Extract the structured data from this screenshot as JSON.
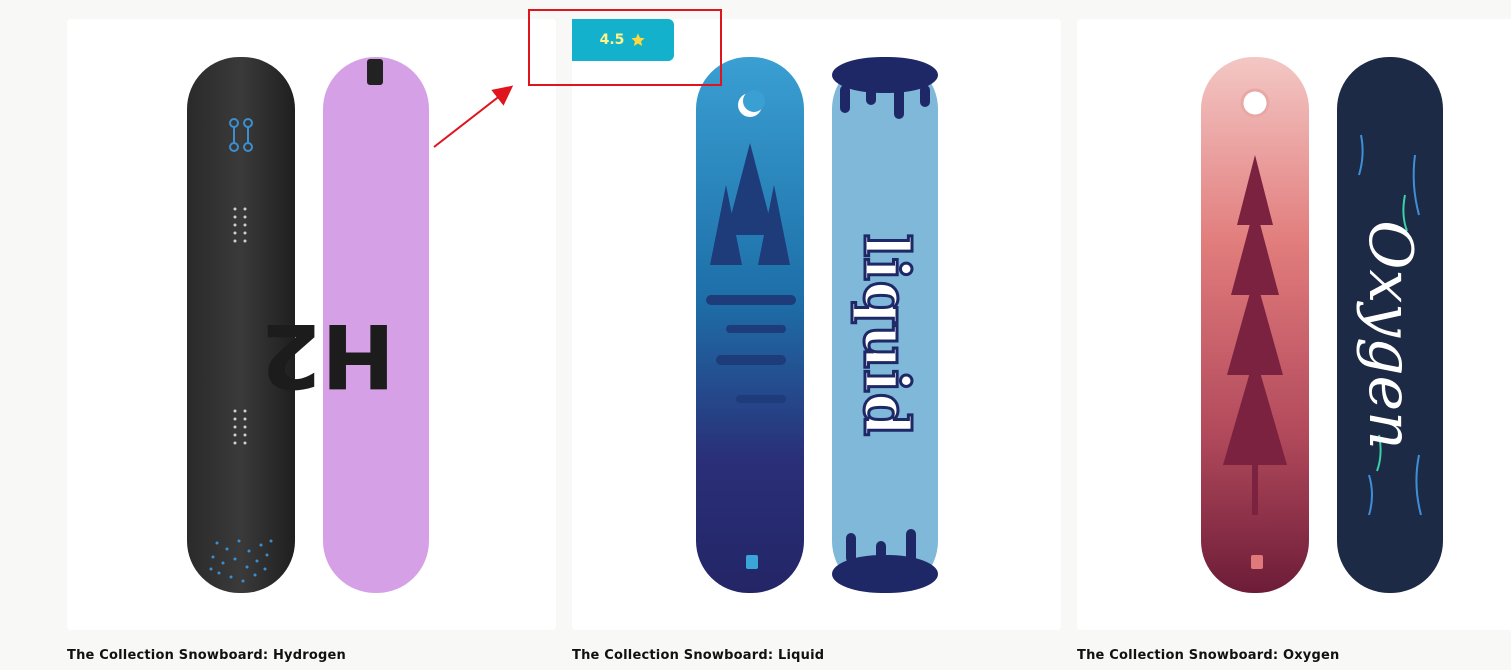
{
  "products": [
    {
      "title": "The Collection Snowboard: Hydrogen",
      "logo_text": "H2"
    },
    {
      "title": "The Collection Snowboard: Liquid",
      "logo_text": "liquid"
    },
    {
      "title": "The Collection Snowboard: Oxygen",
      "logo_text": "Oxygen"
    }
  ],
  "rating": {
    "value": "4.5",
    "icon": "star-icon",
    "color": "#13b1cb"
  },
  "annotation": {
    "box_color": "#e0141d",
    "arrow_color": "#e0141d"
  }
}
